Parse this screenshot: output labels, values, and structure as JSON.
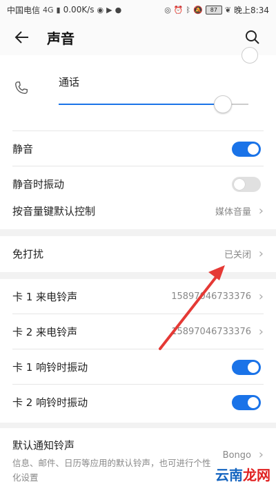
{
  "status_bar": {
    "carrier": "中国电信",
    "net": "4G",
    "speed": "0.00K/s",
    "battery": "87",
    "time": "晚上8:34"
  },
  "app_bar": {
    "title": "声音"
  },
  "volume": {
    "call_label": "通话",
    "call_level": 0.86
  },
  "toggles": {
    "mute_label": "静音",
    "mute_on": true,
    "mute_vibrate_label": "静音时振动",
    "mute_vibrate_on": false
  },
  "volume_key": {
    "label": "按音量键默认控制",
    "value": "媒体音量"
  },
  "dnd": {
    "label": "免打扰",
    "value": "已关闭"
  },
  "ringtones": [
    {
      "label": "卡 1 来电铃声",
      "value": "15897046733376"
    },
    {
      "label": "卡 2 来电铃声",
      "value": "15897046733376"
    }
  ],
  "vibrate_rows": [
    {
      "label": "卡 1 响铃时振动",
      "on": true
    },
    {
      "label": "卡 2 响铃时振动",
      "on": true
    }
  ],
  "notification": {
    "title": "默认通知铃声",
    "desc": "信息、邮件、日历等应用的默认铃声，也可进行个性化设置",
    "value": "Bongo"
  },
  "watermark": {
    "a": "云南",
    "b": "龙网"
  },
  "colors": {
    "accent": "#1a73e8",
    "arrow": "#e53935"
  }
}
